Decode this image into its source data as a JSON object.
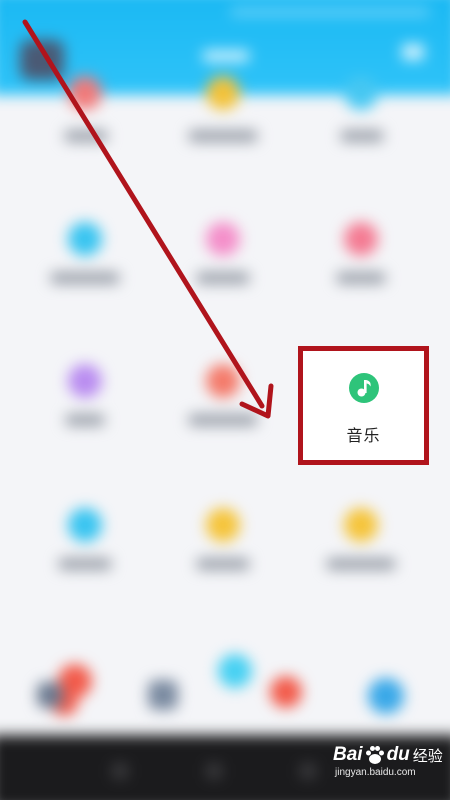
{
  "highlighted_item": {
    "label": "音乐",
    "icon": "music-note-icon",
    "icon_color": "#2ec47a"
  },
  "annotation": {
    "arrow_color": "#b0141c",
    "box_color": "#b0141c"
  },
  "watermark": {
    "brand_left": "Bai",
    "brand_right": "du",
    "brand_cn": "经验",
    "url": "jingyan.baidu.com"
  },
  "colors": {
    "header": "#19b8f3",
    "nav_bar": "#1b1b1d",
    "background": "#f4f5f8"
  }
}
